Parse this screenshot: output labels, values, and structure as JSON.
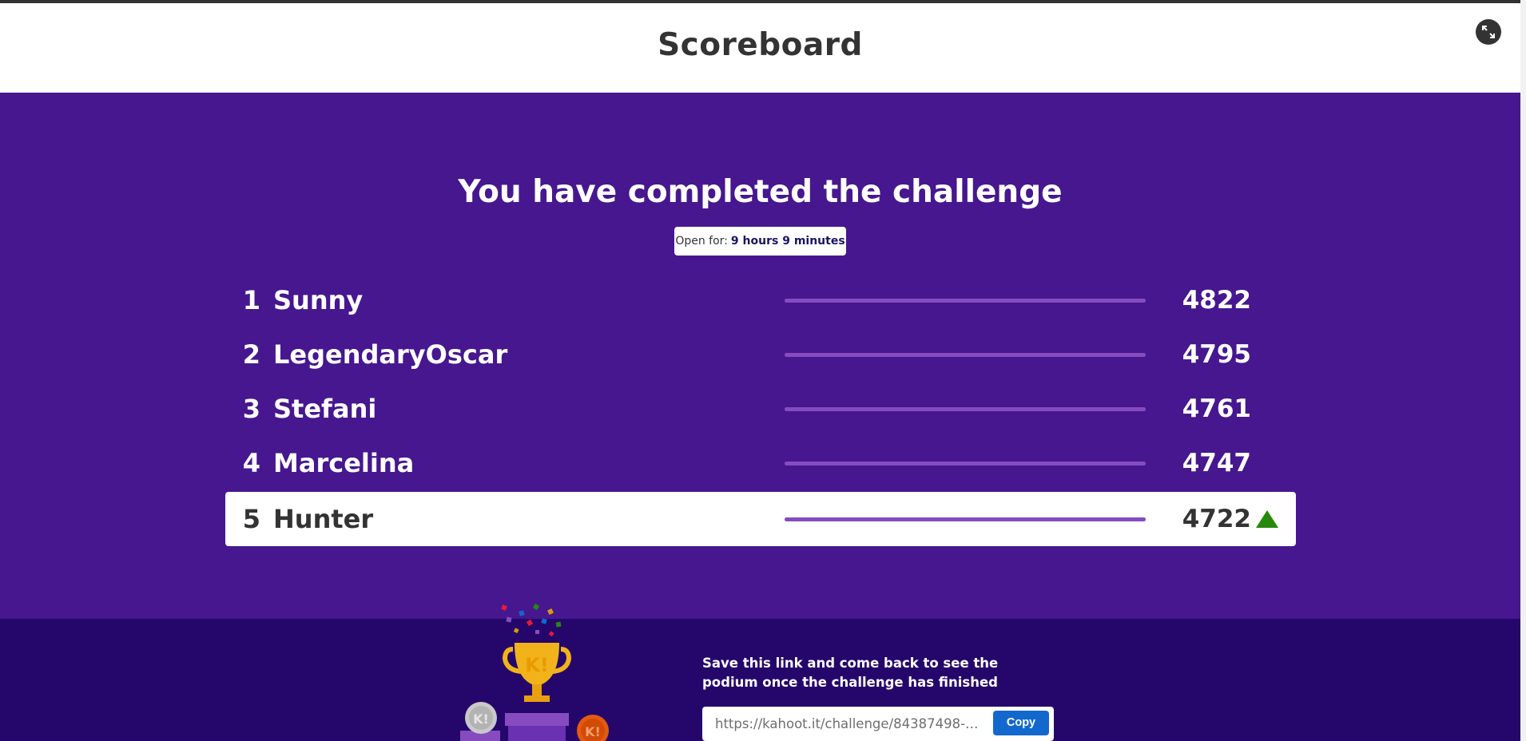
{
  "header": {
    "title": "Scoreboard",
    "fullscreen_icon": "expand-icon"
  },
  "challenge": {
    "title": "You have completed the challenge",
    "open_for_label": "Open for:",
    "open_for_value": "9 hours 9 minutes"
  },
  "scoreboard": [
    {
      "rank": "1",
      "name": "Sunny",
      "score": "4822",
      "bar_fraction": 1.0,
      "is_current_player": false
    },
    {
      "rank": "2",
      "name": "LegendaryOscar",
      "score": "4795",
      "bar_fraction": 1.0,
      "is_current_player": false
    },
    {
      "rank": "3",
      "name": "Stefani",
      "score": "4761",
      "bar_fraction": 1.0,
      "is_current_player": false
    },
    {
      "rank": "4",
      "name": "Marcelina",
      "score": "4747",
      "bar_fraction": 1.0,
      "is_current_player": false
    },
    {
      "rank": "5",
      "name": "Hunter",
      "score": "4722",
      "bar_fraction": 1.0,
      "is_current_player": true,
      "trend_icon": "up-arrow-icon"
    }
  ],
  "footer": {
    "save_text": "Save this link and come back to see the podium once the challenge has finished",
    "link_value": "https://kahoot.it/challenge/84387498-97...",
    "copy_label": "Copy",
    "illustration": "trophy-podium-icon"
  },
  "colors": {
    "brand_purple": "#46178f",
    "footer_purple": "#25076b",
    "bar_purple": "#864cbf",
    "copy_blue": "#1368ce",
    "up_green": "#26890c"
  }
}
